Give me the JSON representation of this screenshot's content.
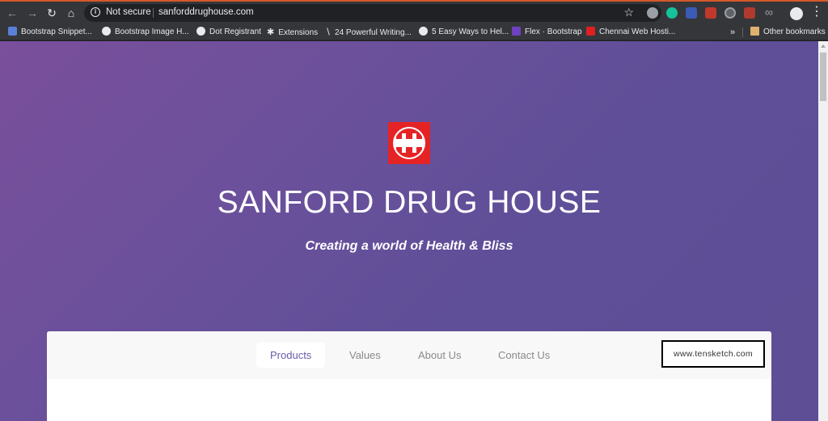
{
  "browser": {
    "security_label": "Not secure",
    "url": "sanforddrughouse.com",
    "bookmarks": [
      "Bootstrap Snippet...",
      "Bootstrap Image H...",
      "Dot Registrant",
      "Extensions",
      "24 Powerful Writing...",
      "5 Easy Ways to Hel...",
      "Flex · Bootstrap",
      "Chennai Web Hosti..."
    ],
    "other_bookmarks": "Other bookmarks"
  },
  "site": {
    "title": "SANFORD DRUG HOUSE",
    "tagline": "Creating a world of Health & Bliss",
    "brand_color": "#e52325",
    "accent_color": "#6a5aa8",
    "nav": [
      "Products",
      "Values",
      "About Us",
      "Contact Us"
    ],
    "active_nav": "Products"
  },
  "watermark": "www.tensketch.com"
}
